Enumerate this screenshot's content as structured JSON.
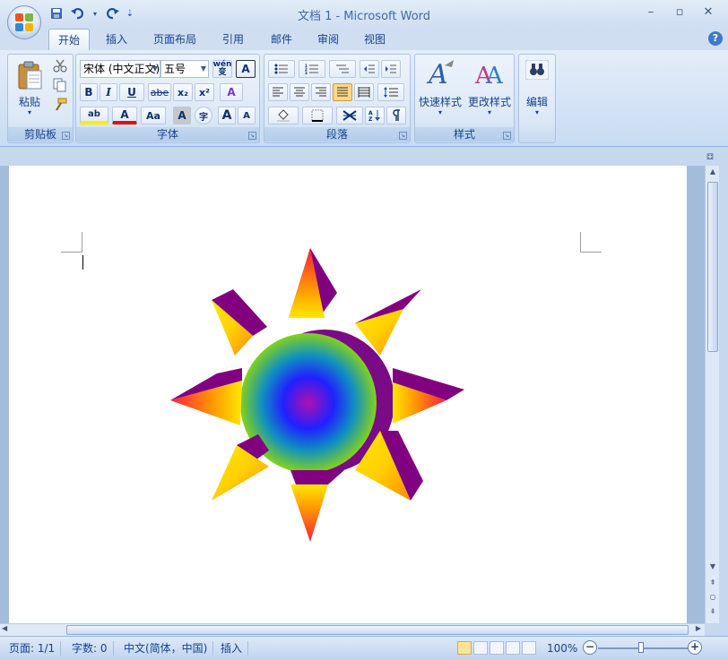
{
  "window": {
    "title": "文档 1 - Microsoft Word",
    "minimize": "–",
    "restore": "▫",
    "close": "✕"
  },
  "qat": {
    "save_icon": "save-icon",
    "undo_icon": "undo-icon",
    "redo_icon": "redo-icon",
    "customize": "⇣"
  },
  "tabs": [
    {
      "label": "开始",
      "active": true
    },
    {
      "label": "插入",
      "active": false
    },
    {
      "label": "页面布局",
      "active": false
    },
    {
      "label": "引用",
      "active": false
    },
    {
      "label": "邮件",
      "active": false
    },
    {
      "label": "审阅",
      "active": false
    },
    {
      "label": "视图",
      "active": false
    }
  ],
  "help": "?",
  "ribbon": {
    "clipboard": {
      "label": "剪贴板",
      "paste": "粘贴",
      "paste_arrow": "▾"
    },
    "font": {
      "label": "字体",
      "font_name": "宋体 (中文正文)",
      "font_size": "五号",
      "wen": "wén\n变",
      "char_border": "A",
      "bold": "B",
      "italic": "I",
      "underline": "U",
      "strike": "abe",
      "subscript": "x₂",
      "superscript": "x²",
      "clear": "A",
      "highlight": "ab",
      "font_color": "A",
      "case": "Aa",
      "char_shading": "A",
      "enclose": "字",
      "grow": "A",
      "shrink": "A"
    },
    "paragraph": {
      "label": "段落"
    },
    "styles": {
      "label": "样式",
      "quick_styles": "快速样式",
      "change_styles": "更改样式"
    },
    "editing": {
      "label": "编辑",
      "edit": "编辑"
    }
  },
  "status": {
    "page": "页面: 1/1",
    "words": "字数: 0",
    "language": "中文(简体，中国)",
    "mode": "插入",
    "zoom": "100%",
    "zoom_out": "−",
    "zoom_in": "+"
  },
  "colors": {
    "ribbon_bg": "#dce8f6",
    "sun_outer": "#800080",
    "sun_center": "#a020a0"
  }
}
